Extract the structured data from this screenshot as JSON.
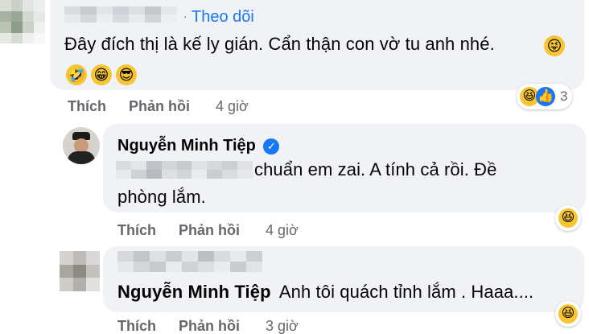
{
  "comment1": {
    "follow_label": "Theo dõi",
    "separator": "·",
    "text": "Đây đích thị là kế ly gián. Cẩn thận con vờ tu anh nhé.",
    "emoji_inline": "😜",
    "emoji_line2": [
      "🤣",
      "😁",
      "😎"
    ],
    "reactions": {
      "icons": [
        "😆",
        "👍"
      ],
      "count": "3"
    },
    "actions": {
      "like": "Thích",
      "reply": "Phản hồi",
      "time": "4 giờ"
    }
  },
  "reply1": {
    "author": "Nguyễn Minh Tiệp",
    "verified_glyph": "✓",
    "text_line1": "chuẩn em zai. A tính cả rồi. Đề",
    "text_line2": "phòng lắm.",
    "reaction_icon": "😆",
    "actions": {
      "like": "Thích",
      "reply": "Phản hồi",
      "time": "4 giờ"
    }
  },
  "reply2": {
    "tagged_name": "Nguyễn Minh Tiệp",
    "text": "Anh tôi quách tỉnh lắm . Haaa....",
    "reaction_icon": "😆",
    "actions": {
      "like": "Thích",
      "reply": "Phản hồi",
      "time": "3 giờ"
    }
  },
  "colors": {
    "bubble": "#f0f2f5",
    "link_blue": "#1877f2",
    "meta_gray": "#65676b",
    "text": "#050505"
  }
}
